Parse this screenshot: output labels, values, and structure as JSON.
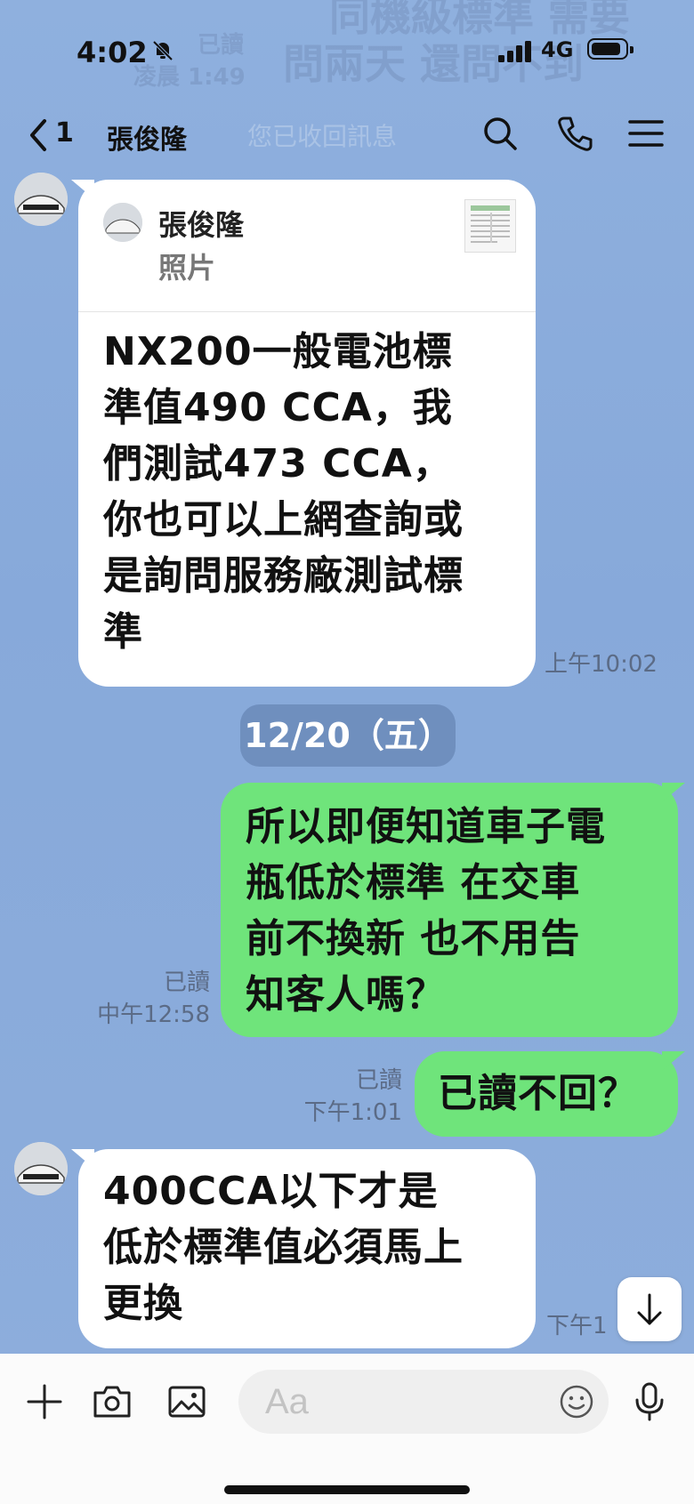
{
  "status_bar": {
    "time": "4:02",
    "network": "4G"
  },
  "background_ghost": {
    "line1": "同機級標準 需要",
    "line2": "問兩天 還問不到",
    "read": "已讀",
    "time": "凌晨 1:49"
  },
  "nav": {
    "unread_count": "1",
    "title": "張俊隆",
    "overlay_text": "您已收回訊息"
  },
  "messages": [
    {
      "direction": "incoming",
      "reply_to": {
        "name": "張俊隆",
        "type": "照片"
      },
      "lines": [
        "NX200一般電池標",
        "準值490 CCA，我",
        "們測試473 CCA，",
        "你也可以上網查詢或",
        "是詢問服務廠測試標",
        "準"
      ],
      "time": "上午10:02"
    },
    {
      "direction": "date",
      "label": "12/20（五）"
    },
    {
      "direction": "outgoing",
      "lines": [
        "所以即便知道車子電",
        "瓶低於標準 在交車",
        "前不換新 也不用告",
        "知客人嗎？"
      ],
      "read": "已讀",
      "time": "中午12:58"
    },
    {
      "direction": "outgoing",
      "lines": [
        "已讀不回？"
      ],
      "read": "已讀",
      "time": "下午1:01"
    },
    {
      "direction": "incoming",
      "lines": [
        "400CCA以下才是",
        "低於標準值必須馬上",
        "更換"
      ],
      "time": "下午1"
    }
  ],
  "input": {
    "placeholder": "Aa"
  },
  "colors": {
    "outgoing_bubble": "#6fe47b",
    "incoming_bubble": "#ffffff",
    "background": "#8aacdb",
    "date_pill": "#6f8fbe"
  },
  "icons": [
    "bell-slash-icon",
    "signal-icon",
    "battery-icon",
    "back-chevron-icon",
    "search-icon",
    "phone-icon",
    "menu-icon",
    "plus-icon",
    "camera-icon",
    "image-icon",
    "emoji-icon",
    "mic-icon",
    "arrow-down-icon"
  ]
}
